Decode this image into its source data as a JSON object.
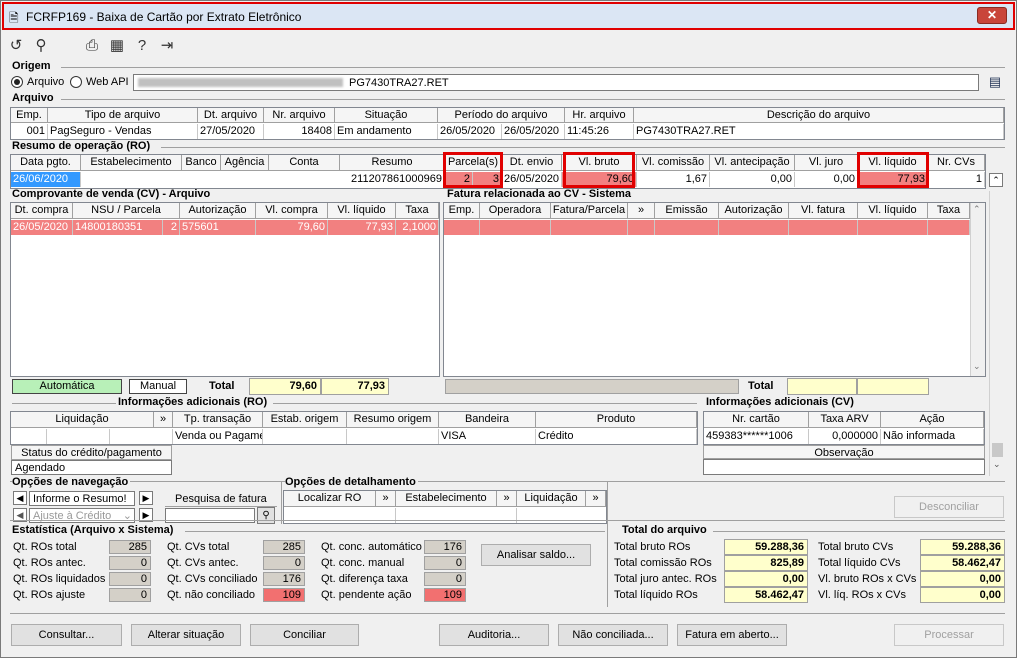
{
  "window": {
    "title": "FCRFP169 - Baixa de Cartão por Extrato Eletrônico",
    "close": "✕"
  },
  "origem": {
    "label": "Origem",
    "radio_arquivo": "Arquivo",
    "radio_webapi": "Web API",
    "path_value": "PG7430TRA27.RET"
  },
  "arquivo": {
    "label": "Arquivo",
    "headers": [
      "Emp.",
      "Tipo de arquivo",
      "Dt. arquivo",
      "Nr. arquivo",
      "Situação",
      "Período do arquivo",
      "Hr. arquivo",
      "Descrição do arquivo"
    ],
    "row": {
      "emp": "001",
      "tipo": "PagSeguro - Vendas",
      "dt": "27/05/2020",
      "nr": "18408",
      "situacao": "Em andamento",
      "periodo_ini": "26/05/2020",
      "periodo_fim": "26/05/2020",
      "hr": "11:45:26",
      "descricao": "PG7430TRA27.RET"
    }
  },
  "resumo": {
    "label": "Resumo de operação (RO)",
    "headers": [
      "Data pgto.",
      "Estabelecimento",
      "Banco",
      "Agência",
      "Conta",
      "Resumo",
      "Parcela(s)",
      "Dt. envio",
      "Vl. bruto",
      "Vl. comissão",
      "Vl. antecipação",
      "Vl. juro",
      "Vl. líquido",
      "Nr. CVs"
    ],
    "row": {
      "data": "26/06/2020",
      "resumo": "211207861000969",
      "parcela": "2",
      "parcelas_total": "3",
      "dt_envio": "26/05/2020",
      "bruto": "79,60",
      "comissao": "1,67",
      "antecipacao": "0,00",
      "juro": "0,00",
      "liquido": "77,93",
      "cvs": "1"
    }
  },
  "cv": {
    "label": "Comprovante de venda (CV) - Arquivo",
    "headers": [
      "Dt. compra",
      "NSU / Parcela",
      "Autorização",
      "Vl. compra",
      "Vl. líquido",
      "Taxa"
    ],
    "row": {
      "dt": "26/05/2020",
      "nsu": "14800180351",
      "parcela": "2",
      "autorizacao": "575601",
      "compra": "79,60",
      "liquido": "77,93",
      "taxa": "2,1000"
    },
    "legend_auto": "Automática",
    "legend_manual": "Manual",
    "total_label": "Total",
    "total_compra": "79,60",
    "total_liquido": "77,93"
  },
  "fatura": {
    "label": "Fatura relacionada ao CV - Sistema",
    "headers": [
      "Emp.",
      "Operadora",
      "Fatura/Parcela",
      "»",
      "Emissão",
      "Autorização",
      "Vl. fatura",
      "Vl. líquido",
      "Taxa"
    ],
    "total_label": "Total"
  },
  "info_ro": {
    "label": "Informações adicionais (RO)",
    "headers": [
      "Liquidação",
      "»",
      "Tp. transação",
      "Estab. origem",
      "Resumo origem",
      "Bandeira",
      "Produto"
    ],
    "row": {
      "tp": "Venda ou Pagame",
      "bandeira": "VISA",
      "produto": "Crédito"
    },
    "status_label": "Status do crédito/pagamento",
    "status_value": "Agendado"
  },
  "info_cv": {
    "label": "Informações adicionais (CV)",
    "headers": [
      "Nr. cartão",
      "Taxa ARV",
      "Ação"
    ],
    "row": {
      "cartao": "459383******1006",
      "taxa": "0,000000",
      "acao": "Não informada"
    },
    "obs_label": "Observação"
  },
  "nav": {
    "label": "Opções de navegação",
    "informe": "Informe o Resumo!",
    "ajuste": "Ajuste à Crédito",
    "pesquisa": "Pesquisa de fatura"
  },
  "detalhe": {
    "label": "Opções de detalhamento",
    "items": [
      "Localizar RO",
      "»",
      "Estabelecimento",
      "»",
      "Liquidação",
      "»"
    ],
    "desconciliar": "Desconciliar"
  },
  "estat": {
    "label": "Estatística (Arquivo x Sistema)",
    "col1": [
      {
        "l": "Qt. ROs total",
        "v": "285"
      },
      {
        "l": "Qt. ROs antec.",
        "v": "0"
      },
      {
        "l": "Qt. ROs liquidados",
        "v": "0"
      },
      {
        "l": "Qt. ROs ajuste",
        "v": "0"
      }
    ],
    "col2": [
      {
        "l": "Qt. CVs total",
        "v": "285"
      },
      {
        "l": "Qt. CVs antec.",
        "v": "0"
      },
      {
        "l": "Qt. CVs conciliado",
        "v": "176"
      },
      {
        "l": "Qt. não conciliado",
        "v": "109"
      }
    ],
    "col3": [
      {
        "l": "Qt. conc. automático",
        "v": "176"
      },
      {
        "l": "Qt. conc. manual",
        "v": "0"
      },
      {
        "l": "Qt. diferença taxa",
        "v": "0"
      },
      {
        "l": "Qt. pendente ação",
        "v": "109"
      }
    ],
    "analisar": "Analisar saldo..."
  },
  "total_arquivo": {
    "label": "Total do arquivo",
    "left": [
      {
        "l": "Total bruto ROs",
        "v": "59.288,36"
      },
      {
        "l": "Total comissão ROs",
        "v": "825,89"
      },
      {
        "l": "Total juro antec. ROs",
        "v": "0,00"
      },
      {
        "l": "Total líquido ROs",
        "v": "58.462,47"
      }
    ],
    "right": [
      {
        "l": "Total bruto CVs",
        "v": "59.288,36"
      },
      {
        "l": "Total líquido CVs",
        "v": "58.462,47"
      },
      {
        "l": "Vl. bruto ROs x CVs",
        "v": "0,00"
      },
      {
        "l": "Vl. líq. ROs x CVs",
        "v": "0,00"
      }
    ]
  },
  "footer": [
    "Consultar...",
    "Alterar situação",
    "Conciliar",
    "Auditoria...",
    "Não conciliada...",
    "Fatura em aberto...",
    "Processar"
  ]
}
